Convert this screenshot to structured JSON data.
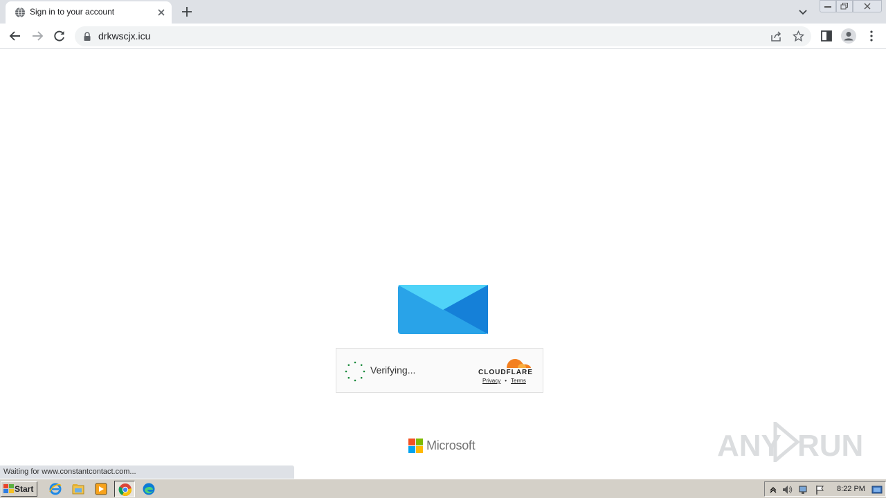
{
  "browser": {
    "tab": {
      "title": "Sign in to your account",
      "favicon": "globe-icon"
    },
    "url": "drkwscjx.icu"
  },
  "page": {
    "captcha": {
      "status_text": "Verifying...",
      "provider": "CLOUDFLARE",
      "privacy_label": "Privacy",
      "separator": "•",
      "terms_label": "Terms",
      "brand_color": "#f38020"
    },
    "footer_brand": "Microsoft",
    "envelope_colors": {
      "body": "#29a3e8",
      "flap": "#4fd3f8",
      "right": "#1580d8"
    }
  },
  "status_bar": "Waiting for www.constantcontact.com...",
  "watermark": {
    "left": "ANY",
    "right": "RUN"
  },
  "taskbar": {
    "start_label": "Start",
    "apps": [
      "internet-explorer-icon",
      "file-explorer-icon",
      "media-player-icon",
      "chrome-icon",
      "edge-icon"
    ],
    "clock": "8:22 PM"
  }
}
